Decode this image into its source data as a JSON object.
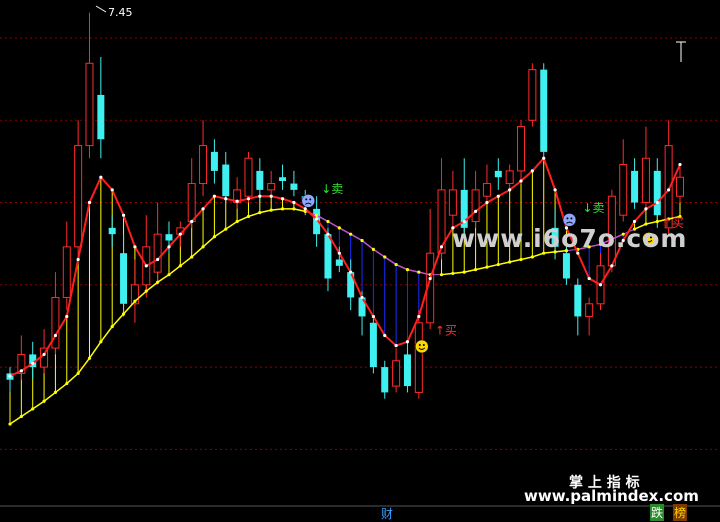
{
  "chart_data": {
    "type": "candlestick",
    "title": "",
    "max_price_label": "7.45",
    "ylim": [
      3.6,
      7.55
    ],
    "grid_prices": [
      7.25,
      6.6,
      5.95,
      5.3,
      4.65,
      4.0
    ],
    "x_count": 60,
    "candles": [
      {
        "o": 4.55,
        "c": 4.6,
        "h": 4.65,
        "l": 4.45,
        "u": false
      },
      {
        "o": 4.6,
        "c": 4.75,
        "h": 4.9,
        "l": 4.55,
        "u": true
      },
      {
        "o": 4.75,
        "c": 4.65,
        "h": 4.85,
        "l": 4.55,
        "u": false
      },
      {
        "o": 4.65,
        "c": 4.8,
        "h": 4.95,
        "l": 4.6,
        "u": true
      },
      {
        "o": 4.8,
        "c": 5.2,
        "h": 5.4,
        "l": 4.75,
        "u": true
      },
      {
        "o": 5.2,
        "c": 5.6,
        "h": 5.8,
        "l": 5.1,
        "u": true
      },
      {
        "o": 5.6,
        "c": 6.4,
        "h": 6.6,
        "l": 5.5,
        "u": true
      },
      {
        "o": 6.4,
        "c": 7.05,
        "h": 7.45,
        "l": 6.3,
        "u": true
      },
      {
        "o": 6.8,
        "c": 6.45,
        "h": 7.1,
        "l": 6.3,
        "u": false
      },
      {
        "o": 5.75,
        "c": 5.7,
        "h": 5.85,
        "l": 5.6,
        "u": false
      },
      {
        "o": 5.55,
        "c": 5.15,
        "h": 5.7,
        "l": 5.05,
        "u": false
      },
      {
        "o": 5.15,
        "c": 5.3,
        "h": 5.5,
        "l": 5.0,
        "u": true
      },
      {
        "o": 5.3,
        "c": 5.6,
        "h": 5.85,
        "l": 5.2,
        "u": true
      },
      {
        "o": 5.4,
        "c": 5.7,
        "h": 5.95,
        "l": 5.3,
        "u": true
      },
      {
        "o": 5.7,
        "c": 5.65,
        "h": 5.8,
        "l": 5.55,
        "u": false
      },
      {
        "o": 5.7,
        "c": 5.75,
        "h": 5.8,
        "l": 5.6,
        "u": true
      },
      {
        "o": 5.8,
        "c": 6.1,
        "h": 6.3,
        "l": 5.75,
        "u": true
      },
      {
        "o": 6.1,
        "c": 6.4,
        "h": 6.6,
        "l": 6.0,
        "u": true
      },
      {
        "o": 6.35,
        "c": 6.2,
        "h": 6.45,
        "l": 6.1,
        "u": false
      },
      {
        "o": 6.25,
        "c": 6.0,
        "h": 6.35,
        "l": 5.95,
        "u": false
      },
      {
        "o": 5.95,
        "c": 6.05,
        "h": 6.15,
        "l": 5.9,
        "u": true
      },
      {
        "o": 6.0,
        "c": 6.3,
        "h": 6.35,
        "l": 5.95,
        "u": true
      },
      {
        "o": 6.2,
        "c": 6.05,
        "h": 6.3,
        "l": 5.95,
        "u": false
      },
      {
        "o": 6.05,
        "c": 6.1,
        "h": 6.2,
        "l": 6.0,
        "u": true
      },
      {
        "o": 6.15,
        "c": 6.12,
        "h": 6.25,
        "l": 6.05,
        "u": false
      },
      {
        "o": 6.1,
        "c": 6.05,
        "h": 6.2,
        "l": 6.0,
        "u": false
      },
      {
        "o": 6.0,
        "c": 5.95,
        "h": 6.05,
        "l": 5.85,
        "u": false
      },
      {
        "o": 5.9,
        "c": 5.7,
        "h": 6.0,
        "l": 5.6,
        "u": false
      },
      {
        "o": 5.7,
        "c": 5.35,
        "h": 5.75,
        "l": 5.25,
        "u": false
      },
      {
        "o": 5.5,
        "c": 5.45,
        "h": 5.6,
        "l": 5.4,
        "u": false
      },
      {
        "o": 5.4,
        "c": 5.2,
        "h": 5.5,
        "l": 5.1,
        "u": false
      },
      {
        "o": 5.2,
        "c": 5.05,
        "h": 5.25,
        "l": 4.9,
        "u": false
      },
      {
        "o": 5.0,
        "c": 4.65,
        "h": 5.05,
        "l": 4.6,
        "u": false
      },
      {
        "o": 4.65,
        "c": 4.45,
        "h": 4.7,
        "l": 4.4,
        "u": false
      },
      {
        "o": 4.5,
        "c": 4.7,
        "h": 4.8,
        "l": 4.45,
        "u": true
      },
      {
        "o": 4.75,
        "c": 4.5,
        "h": 4.85,
        "l": 4.45,
        "u": false
      },
      {
        "o": 4.45,
        "c": 5.0,
        "h": 5.1,
        "l": 4.4,
        "u": true
      },
      {
        "o": 5.0,
        "c": 5.55,
        "h": 5.9,
        "l": 4.95,
        "u": true
      },
      {
        "o": 5.55,
        "c": 6.05,
        "h": 6.3,
        "l": 5.5,
        "u": true
      },
      {
        "o": 5.85,
        "c": 6.05,
        "h": 6.2,
        "l": 5.75,
        "u": true
      },
      {
        "o": 6.05,
        "c": 5.75,
        "h": 6.3,
        "l": 5.7,
        "u": false
      },
      {
        "o": 5.8,
        "c": 6.05,
        "h": 6.2,
        "l": 5.75,
        "u": true
      },
      {
        "o": 6.0,
        "c": 6.1,
        "h": 6.25,
        "l": 5.95,
        "u": true
      },
      {
        "o": 6.2,
        "c": 6.15,
        "h": 6.3,
        "l": 6.05,
        "u": false
      },
      {
        "o": 6.1,
        "c": 6.2,
        "h": 6.25,
        "l": 6.05,
        "u": true
      },
      {
        "o": 6.2,
        "c": 6.55,
        "h": 6.6,
        "l": 6.1,
        "u": true
      },
      {
        "o": 6.6,
        "c": 7.0,
        "h": 7.05,
        "l": 6.55,
        "u": true
      },
      {
        "o": 7.0,
        "c": 6.35,
        "h": 7.05,
        "l": 6.3,
        "u": false
      },
      {
        "o": 5.75,
        "c": 5.6,
        "h": 5.9,
        "l": 5.5,
        "u": false
      },
      {
        "o": 5.55,
        "c": 5.35,
        "h": 5.6,
        "l": 5.3,
        "u": false
      },
      {
        "o": 5.3,
        "c": 5.05,
        "h": 5.35,
        "l": 4.9,
        "u": false
      },
      {
        "o": 5.05,
        "c": 5.15,
        "h": 5.2,
        "l": 4.9,
        "u": true
      },
      {
        "o": 5.15,
        "c": 5.45,
        "h": 5.55,
        "l": 5.1,
        "u": true
      },
      {
        "o": 5.45,
        "c": 6.0,
        "h": 6.05,
        "l": 5.4,
        "u": true
      },
      {
        "o": 5.85,
        "c": 6.25,
        "h": 6.45,
        "l": 5.8,
        "u": true
      },
      {
        "o": 6.2,
        "c": 5.95,
        "h": 6.3,
        "l": 5.9,
        "u": false
      },
      {
        "o": 5.95,
        "c": 6.3,
        "h": 6.55,
        "l": 5.9,
        "u": true
      },
      {
        "o": 6.2,
        "c": 5.85,
        "h": 6.3,
        "l": 5.75,
        "u": false
      },
      {
        "o": 5.75,
        "c": 6.4,
        "h": 6.6,
        "l": 5.7,
        "u": true
      },
      {
        "o": 6.0,
        "c": 6.15,
        "h": 6.25,
        "l": 5.95,
        "u": true
      }
    ],
    "red_line": [
      4.58,
      4.62,
      4.68,
      4.75,
      4.9,
      5.05,
      5.5,
      5.95,
      6.15,
      6.05,
      5.85,
      5.6,
      5.45,
      5.5,
      5.6,
      5.7,
      5.8,
      5.9,
      6.0,
      5.98,
      5.96,
      5.98,
      6.0,
      6.0,
      5.98,
      5.95,
      5.9,
      5.82,
      5.7,
      5.55,
      5.4,
      5.2,
      5.05,
      4.9,
      4.82,
      4.85,
      5.05,
      5.35,
      5.6,
      5.75,
      5.8,
      5.88,
      5.95,
      6.0,
      6.05,
      6.12,
      6.2,
      6.3,
      6.05,
      5.75,
      5.55,
      5.35,
      5.3,
      5.45,
      5.65,
      5.8,
      5.9,
      5.95,
      6.05,
      6.25
    ],
    "yellow_line": [
      4.2,
      4.26,
      4.32,
      4.38,
      4.45,
      4.52,
      4.6,
      4.72,
      4.85,
      4.97,
      5.07,
      5.17,
      5.25,
      5.32,
      5.38,
      5.45,
      5.52,
      5.6,
      5.68,
      5.74,
      5.8,
      5.84,
      5.87,
      5.89,
      5.9,
      5.9,
      5.88,
      5.85,
      5.8,
      5.75,
      5.7,
      5.65,
      5.58,
      5.52,
      5.46,
      5.42,
      5.4,
      5.38,
      5.38,
      5.39,
      5.4,
      5.42,
      5.44,
      5.46,
      5.48,
      5.5,
      5.52,
      5.55,
      5.56,
      5.57,
      5.58,
      5.6,
      5.62,
      5.66,
      5.7,
      5.74,
      5.78,
      5.8,
      5.82,
      5.84
    ],
    "signals": [
      {
        "type": "sell",
        "i": 26,
        "text": "↓卖",
        "face": "sad"
      },
      {
        "type": "buy",
        "i": 36,
        "text": "↑买",
        "face": "smile"
      },
      {
        "type": "sell",
        "i": 49,
        "text": "↓卖",
        "face": "sad"
      },
      {
        "type": "buy",
        "i": 56,
        "text": "↑买",
        "face": "smile"
      }
    ],
    "colors": {
      "up": "#ff2a2a",
      "down": "#3ff0f0",
      "red_line": "#ff1f1f",
      "yellow_line": "#ffff00",
      "grid": "#8b0000",
      "purple_line": "#c050d0",
      "fill_down": "#1a2cff"
    }
  },
  "watermark": {
    "site_big": "www.i6o7o.com",
    "title": "掌 上 指 标",
    "site": "www.palmindex.com"
  },
  "bottom_labels": {
    "cai": "财",
    "die": "跌",
    "bang": "榜"
  }
}
